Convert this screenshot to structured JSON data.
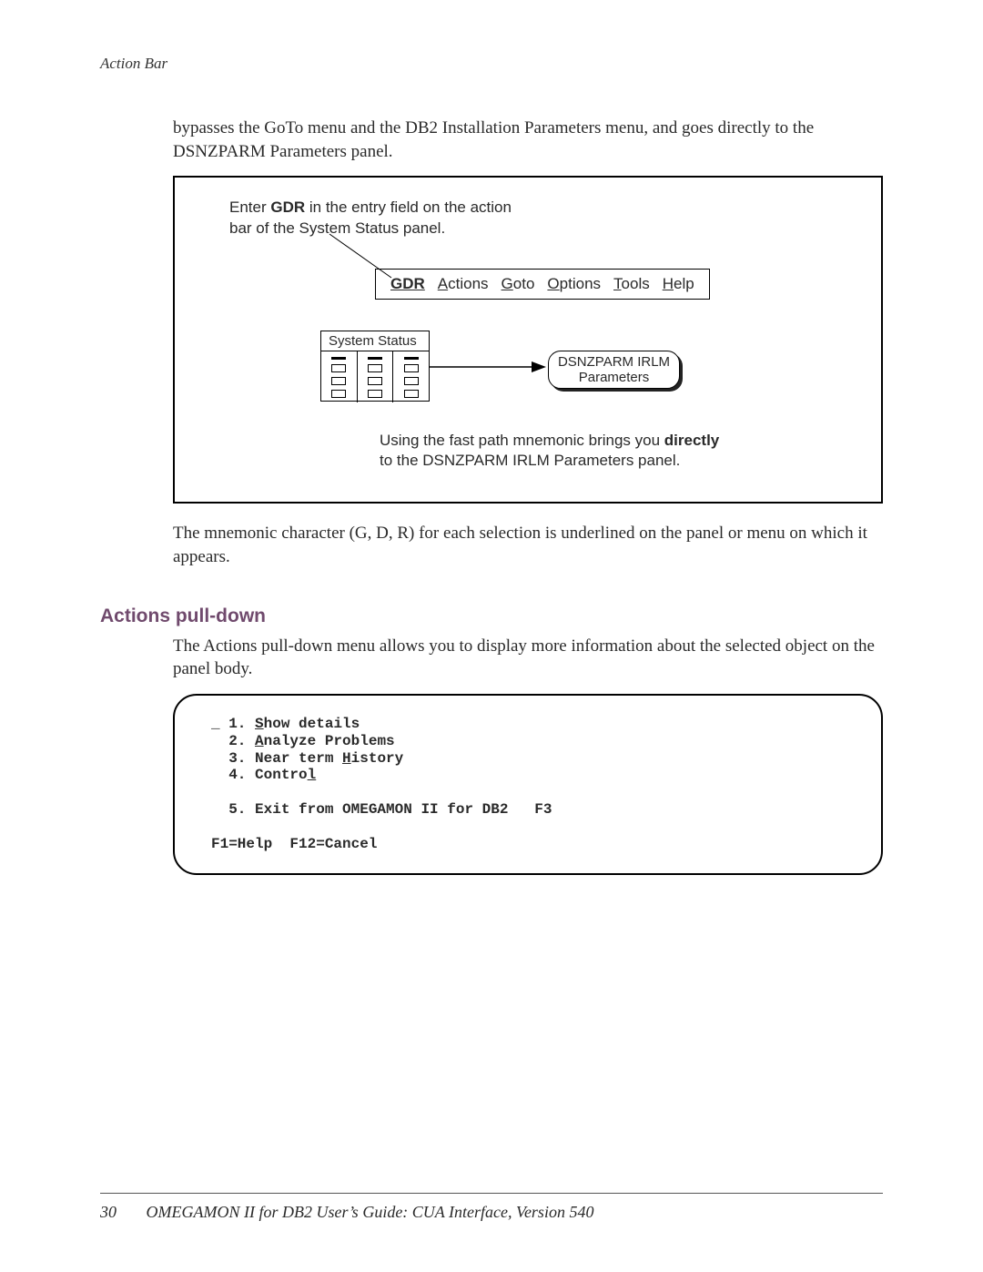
{
  "header": {
    "running": "Action Bar"
  },
  "intro": "bypasses the GoTo menu and the DB2 Installation Parameters menu, and goes directly to the DSNZPARM Parameters panel.",
  "figure": {
    "caption_pre": "Enter ",
    "caption_bold": "GDR",
    "caption_post": " in the entry field on the action bar of the System Status panel.",
    "menubar": {
      "gdr": "GDR",
      "items": [
        {
          "u": "A",
          "rest": "ctions"
        },
        {
          "u": "G",
          "rest": "oto"
        },
        {
          "u": "O",
          "rest": "ptions"
        },
        {
          "u": "T",
          "rest": "ools"
        },
        {
          "u": "H",
          "rest": "elp"
        }
      ]
    },
    "mini_title": "System Status",
    "target_l1": "DSNZPARM IRLM",
    "target_l2": "Parameters",
    "note_pre": "Using the fast path mnemonic brings you ",
    "note_bold": "directly",
    "note_post": " to the DSNZPARM IRLM Parameters panel."
  },
  "para2": "The mnemonic character (G, D, R) for each selection is underlined on the panel or menu on which it appears.",
  "section_title": "Actions pull-down",
  "section_intro": "The Actions pull-down menu allows you to display more information about the selected object on the panel body.",
  "terminal": {
    "prompt": "_ ",
    "lines": [
      {
        "n": "1. ",
        "u": "S",
        "rest": "how details"
      },
      {
        "n": "2. ",
        "u": "A",
        "rest": "nalyze Problems"
      },
      {
        "n": "3. Near term ",
        "u": "H",
        "rest": "istory"
      },
      {
        "n": "4. Contro",
        "u": "l",
        "rest": ""
      }
    ],
    "line5": "5. Exit from OMEGAMON II for DB2   F3",
    "footer": "F1=Help  F12=Cancel"
  },
  "footer": {
    "page": "30",
    "title": "OMEGAMON II for DB2 User’s Guide: CUA Interface, Version 540"
  }
}
